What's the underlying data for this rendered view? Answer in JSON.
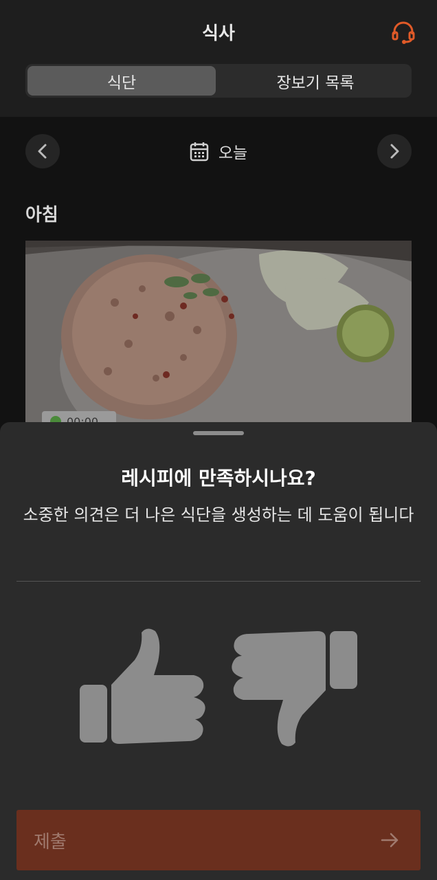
{
  "header": {
    "title": "식사",
    "support_icon": "headset-icon",
    "accent_color": "#e05a28"
  },
  "tabs": [
    {
      "label": "식단",
      "active": true
    },
    {
      "label": "장보기 목록",
      "active": false
    }
  ],
  "date_nav": {
    "prev_icon": "chevron-left-icon",
    "next_icon": "chevron-right-icon",
    "calendar_icon": "calendar-icon",
    "label": "오늘"
  },
  "meal": {
    "title": "아침",
    "image": "fried-rice-photo",
    "time_label": "00:00"
  },
  "feedback_sheet": {
    "title": "레시피에 만족하시나요?",
    "subtitle": "소중한 의견은 더 나은 식단을 생성하는 데 도움이 됩니다",
    "thumbs_up_icon": "thumbs-up-icon",
    "thumbs_down_icon": "thumbs-down-icon",
    "submit_label": "제출",
    "submit_icon": "arrow-right-icon",
    "submit_color": "#6a2f1e"
  }
}
